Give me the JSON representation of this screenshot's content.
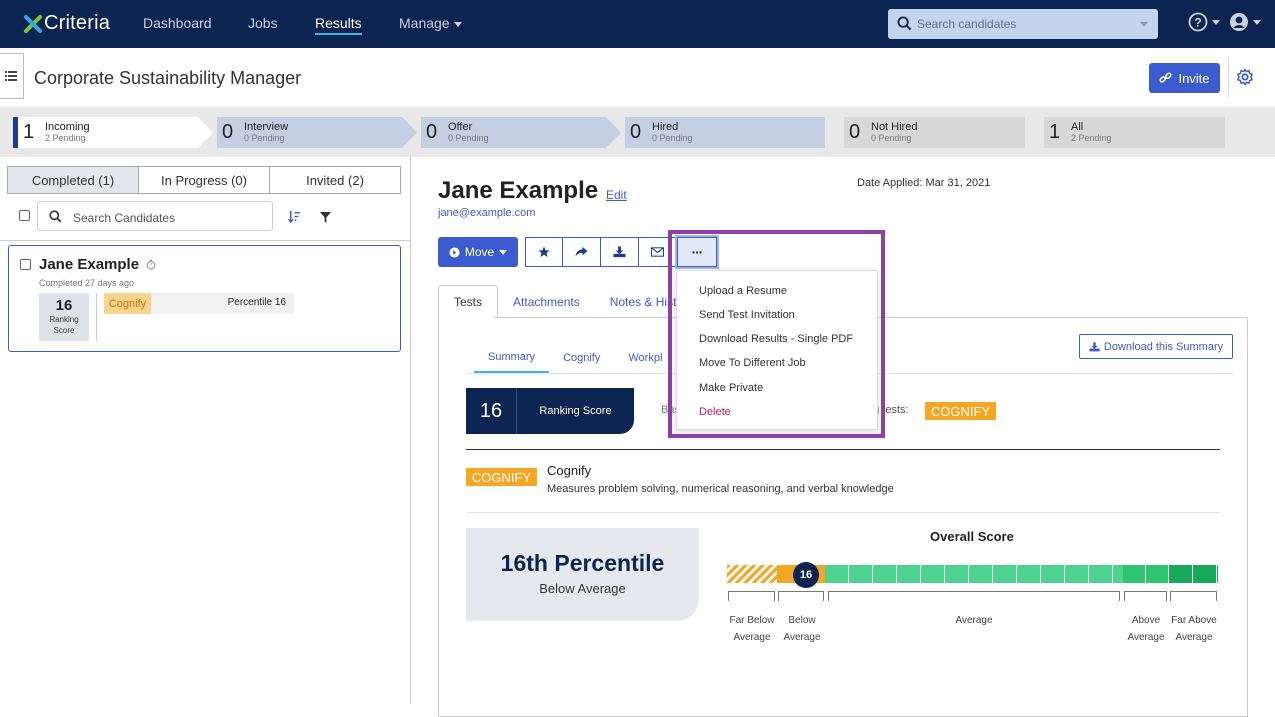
{
  "nav": {
    "logo_text": "Criteria",
    "items": [
      {
        "label": "Dashboard"
      },
      {
        "label": "Jobs"
      },
      {
        "label": "Results"
      },
      {
        "label": "Manage"
      }
    ],
    "search_placeholder": "Search candidates",
    "help_icon": "question-circle-icon",
    "user_icon": "user-circle-icon"
  },
  "header": {
    "job_title": "Corporate Sustainability Manager",
    "invite_label": "Invite"
  },
  "stages": [
    {
      "count": "1",
      "label": "Incoming",
      "sub": "2 Pending"
    },
    {
      "count": "0",
      "label": "Interview",
      "sub": "0 Pending"
    },
    {
      "count": "0",
      "label": "Offer",
      "sub": "0 Pending"
    },
    {
      "count": "0",
      "label": "Hired",
      "sub": "0 Pending"
    },
    {
      "count": "0",
      "label": "Not Hired",
      "sub": "0 Pending"
    },
    {
      "count": "1",
      "label": "All",
      "sub": "2 Pending"
    }
  ],
  "left": {
    "tabs": [
      {
        "label": "Completed (1)"
      },
      {
        "label": "In Progress (0)"
      },
      {
        "label": "Invited (2)"
      }
    ],
    "search_placeholder": "Search Candidates",
    "candidate": {
      "name": "Jane Example",
      "sub": "Completed 27 days ago",
      "rank": "16",
      "rank_label": "Ranking Score",
      "test": "Cognify",
      "percentile": "Percentile 16"
    }
  },
  "main": {
    "name": "Jane Example",
    "edit": "Edit",
    "email": "jane@example.com",
    "date_applied": "Date Applied: Mar 31, 2021",
    "move_label": "Move",
    "dropdown": [
      {
        "label": "Upload a Resume"
      },
      {
        "label": "Send Test Invitation"
      },
      {
        "label": "Download Results - Single PDF"
      },
      {
        "label": "Move To Different Job"
      },
      {
        "label": "Make Private"
      },
      {
        "label": "Delete"
      }
    ],
    "tabs": [
      {
        "label": "Tests"
      },
      {
        "label": "Attachments"
      },
      {
        "label": "Notes & Hist"
      }
    ],
    "download_summary": "Download this Summary",
    "subtabs": [
      {
        "label": "Summary"
      },
      {
        "label": "Cognify"
      },
      {
        "label": "Workpl"
      }
    ],
    "ranking_score": "16",
    "ranking_label": "Ranking Score",
    "based_prefix": "Bas",
    "based_suffix": "ng tests:",
    "badge": "COGNIFY",
    "test_name": "Cognify",
    "test_desc": "Measures problem solving, numerical reasoning, and verbal knowledge",
    "percentile_big": "16th Percentile",
    "percentile_sub": "Below Average",
    "overall_title": "Overall Score",
    "marker": "16",
    "bands": [
      {
        "label": "Far Below Average"
      },
      {
        "label": "Below Average"
      },
      {
        "label": "Average"
      },
      {
        "label": "Above Average"
      },
      {
        "label": "Far Above Average"
      }
    ],
    "colors": {
      "accent": "#3b5ccf",
      "navy": "#0b2451",
      "orange": "#f5a623",
      "green": "#4ed38f",
      "highlight": "#8e3fa1"
    }
  }
}
